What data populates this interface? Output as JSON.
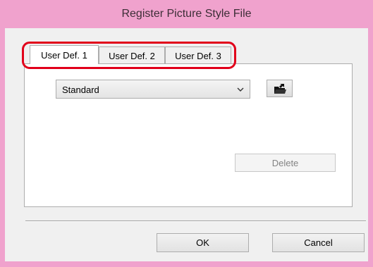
{
  "window": {
    "title": "Register Picture Style File"
  },
  "tabs": [
    {
      "label": "User Def. 1",
      "active": true
    },
    {
      "label": "User Def. 2",
      "active": false
    },
    {
      "label": "User Def. 3",
      "active": false
    }
  ],
  "style_select": {
    "value": "Standard"
  },
  "load_button": {
    "icon": "open-file-icon"
  },
  "buttons": {
    "delete": "Delete",
    "ok": "OK",
    "cancel": "Cancel"
  },
  "colors": {
    "title_bar": "#f0a2cd",
    "highlight": "#e1001a"
  }
}
